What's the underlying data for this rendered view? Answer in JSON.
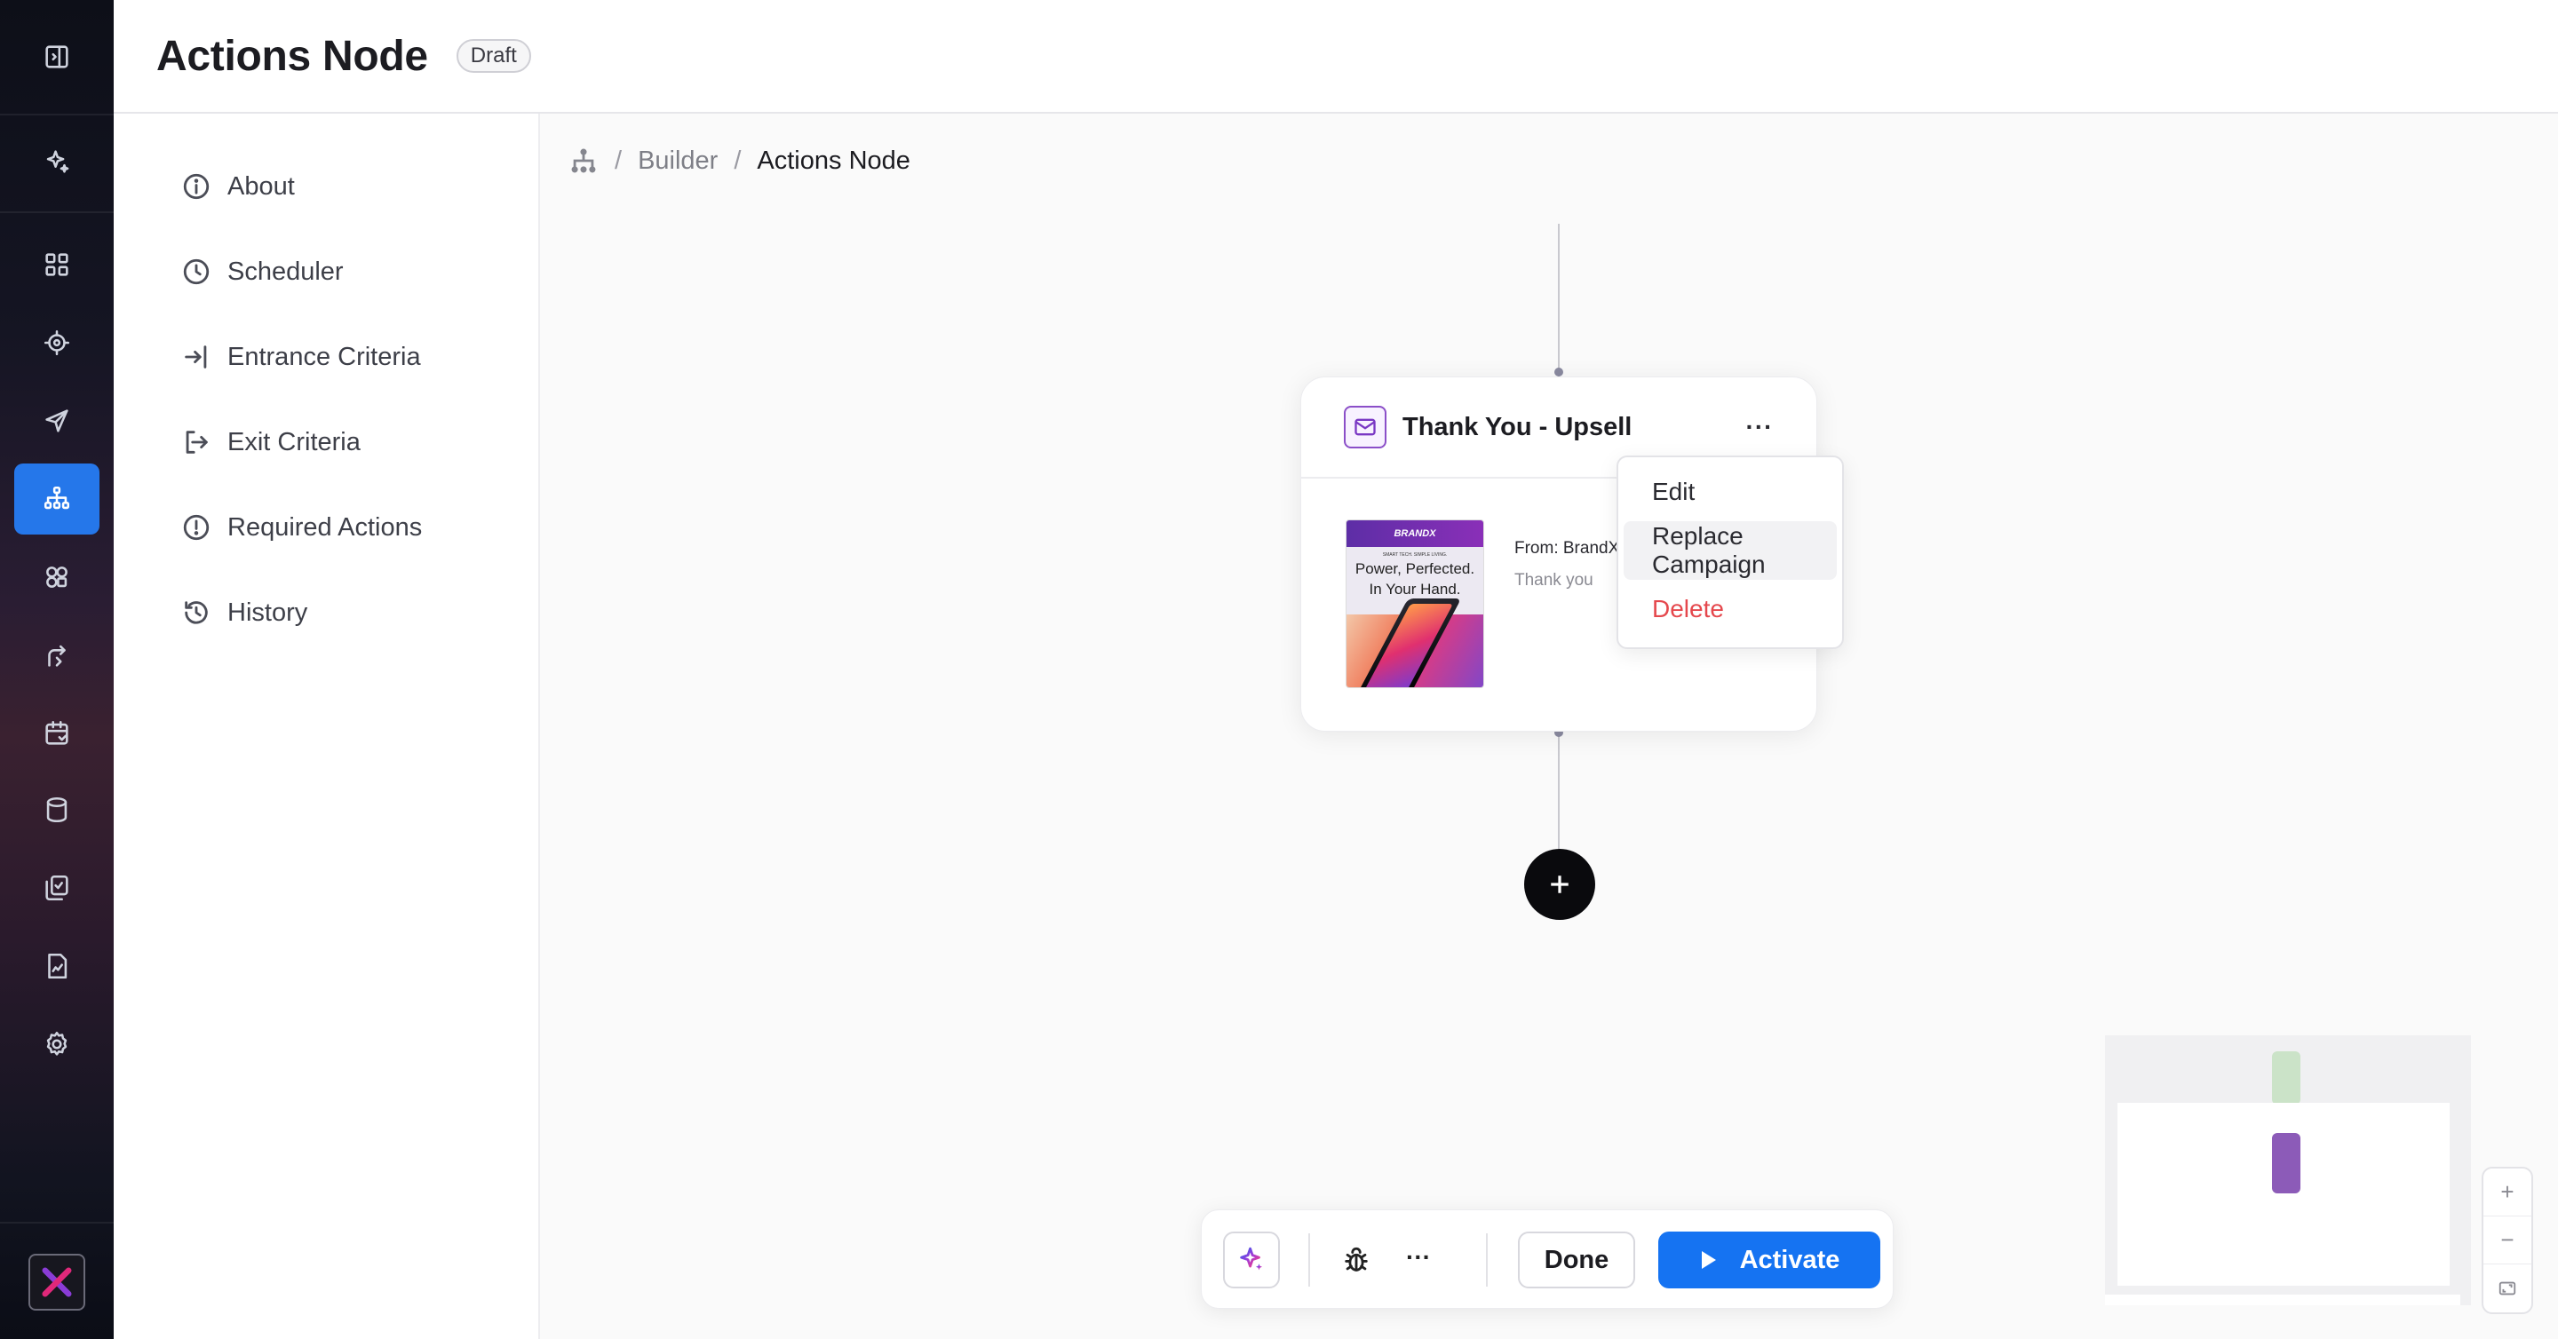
{
  "header": {
    "title": "Actions Node",
    "status_badge": "Draft"
  },
  "rail": {
    "items": [
      {
        "icon": "sidebar-toggle-icon"
      },
      {
        "icon": "sparkle-icon"
      },
      {
        "icon": "dashboard-grid-icon"
      },
      {
        "icon": "target-icon"
      },
      {
        "icon": "send-icon"
      },
      {
        "icon": "journey-tree-icon",
        "active": true
      },
      {
        "icon": "segments-icon"
      },
      {
        "icon": "flow-icon"
      },
      {
        "icon": "calendar-icon"
      },
      {
        "icon": "database-icon"
      },
      {
        "icon": "documents-icon"
      },
      {
        "icon": "report-icon"
      },
      {
        "icon": "gear-icon"
      }
    ],
    "logo": "brand-x-logo"
  },
  "nav": {
    "items": [
      {
        "label": "About",
        "icon": "info-icon"
      },
      {
        "label": "Scheduler",
        "icon": "clock-icon"
      },
      {
        "label": "Entrance Criteria",
        "icon": "enter-icon"
      },
      {
        "label": "Exit Criteria",
        "icon": "exit-icon"
      },
      {
        "label": "Required Actions",
        "icon": "alert-circle-icon"
      },
      {
        "label": "History",
        "icon": "history-icon"
      }
    ]
  },
  "breadcrumb": {
    "icon": "tree-icon",
    "separator": "/",
    "builder": "Builder",
    "current": "Actions Node"
  },
  "node": {
    "title": "Thank You - Upsell",
    "more": "···",
    "from": "From: BrandX",
    "subject": "Thank you",
    "thumbnail": {
      "brand": "BRANDX",
      "small_text": "SMART TECH. SIMPLE LIVING.",
      "headline_1": "Power, Perfected.",
      "headline_2": "In Your Hand."
    }
  },
  "context_menu": {
    "items": [
      "Edit",
      "Replace Campaign",
      "Delete"
    ]
  },
  "toolbar": {
    "more": "···",
    "done_label": "Done",
    "activate_label": "Activate"
  },
  "zoom": {
    "plus": "+",
    "minus": "−"
  },
  "colors": {
    "accent": "#1573f2",
    "active_rail": "#2577ea",
    "danger": "#e5484d",
    "email_node": "#8c5bb8"
  }
}
